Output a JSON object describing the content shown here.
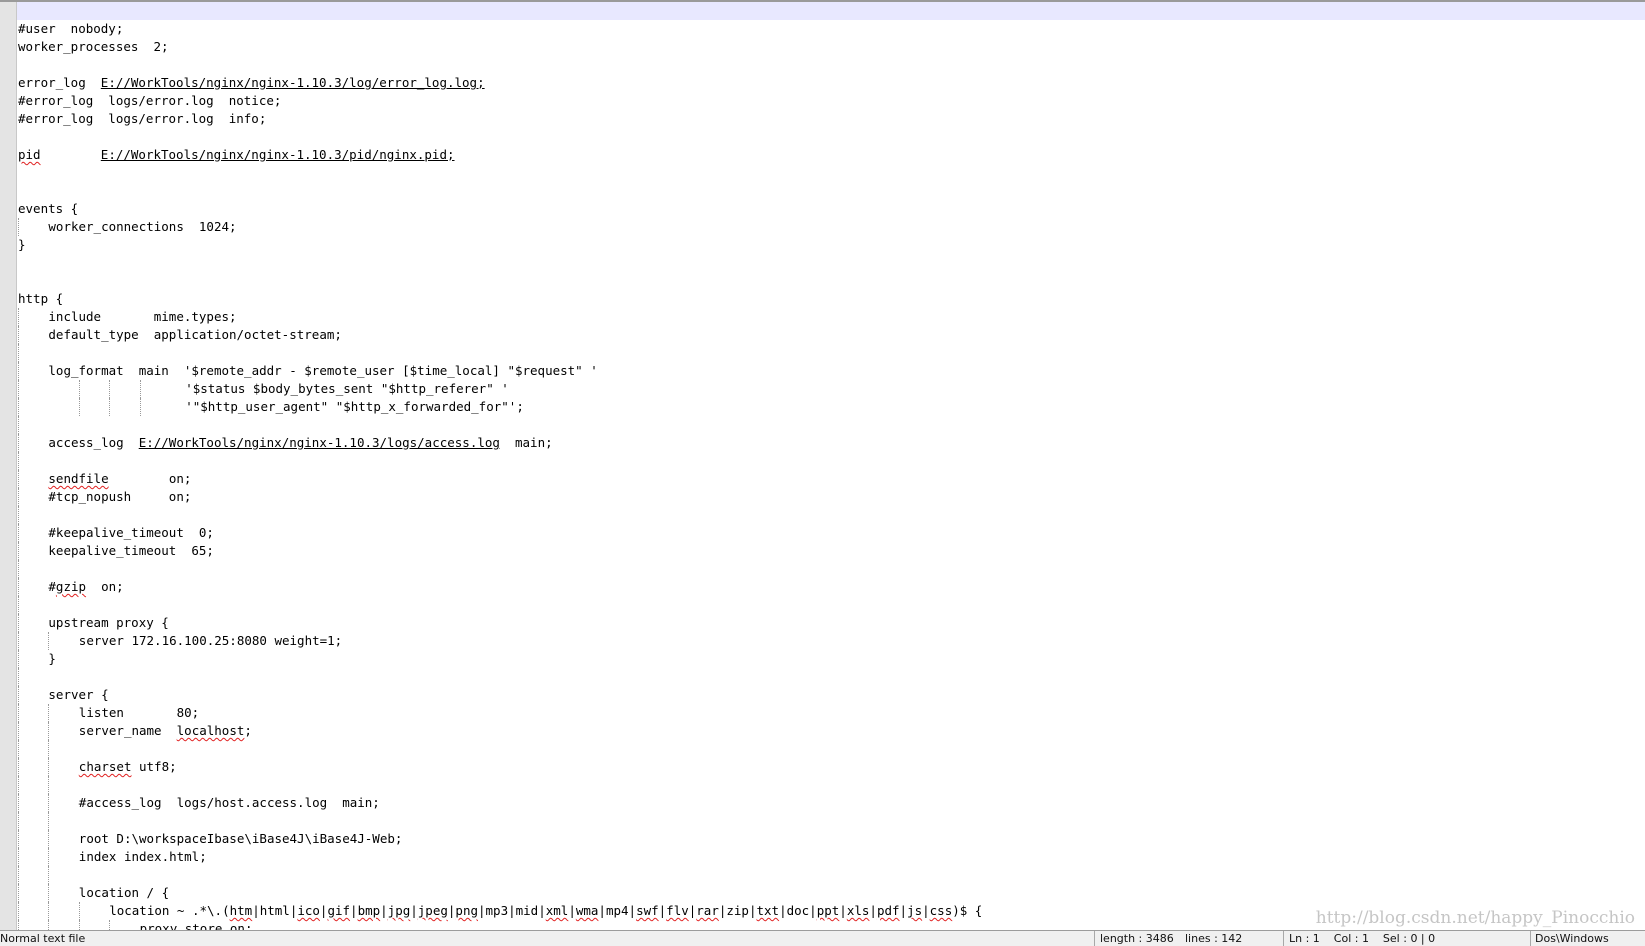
{
  "editor": {
    "lines": [
      {
        "indent": 0,
        "segs": [
          {
            "t": "#user  nobody;"
          }
        ]
      },
      {
        "indent": 0,
        "segs": [
          {
            "t": "worker_processes  2;"
          }
        ]
      },
      {
        "indent": 0,
        "segs": []
      },
      {
        "indent": 0,
        "segs": [
          {
            "t": "error_log  "
          },
          {
            "t": "E://WorkTools/nginx/nginx-1.10.3/log/error_log.log;",
            "s": "ul"
          }
        ]
      },
      {
        "indent": 0,
        "segs": [
          {
            "t": "#error_log  logs/error.log  notice;"
          }
        ]
      },
      {
        "indent": 0,
        "segs": [
          {
            "t": "#error_log  logs/error.log  info;"
          }
        ]
      },
      {
        "indent": 0,
        "segs": []
      },
      {
        "indent": 0,
        "segs": [
          {
            "t": "pid",
            "s": "sq"
          },
          {
            "t": "        "
          },
          {
            "t": "E://WorkTools/nginx/nginx-1.10.3/pid/nginx.pid;",
            "s": "ul"
          }
        ]
      },
      {
        "indent": 0,
        "segs": []
      },
      {
        "indent": 0,
        "segs": []
      },
      {
        "indent": 0,
        "segs": [
          {
            "t": "events {"
          }
        ]
      },
      {
        "indent": 1,
        "segs": [
          {
            "t": "worker_connections  1024;"
          }
        ]
      },
      {
        "indent": 0,
        "segs": [
          {
            "t": "}"
          }
        ]
      },
      {
        "indent": 0,
        "segs": []
      },
      {
        "indent": 0,
        "segs": []
      },
      {
        "indent": 0,
        "segs": [
          {
            "t": "http {"
          }
        ]
      },
      {
        "indent": 1,
        "segs": [
          {
            "t": "include       mime.types;"
          }
        ]
      },
      {
        "indent": 1,
        "segs": [
          {
            "t": "default_type  application/octet-stream;"
          }
        ]
      },
      {
        "indent": 1,
        "segs": []
      },
      {
        "indent": 1,
        "segs": [
          {
            "t": "log_format  main  '$remote_addr - $remote_user [$time_local] \"$request\" '"
          }
        ]
      },
      {
        "indent": 1,
        "cont": true,
        "segs": [
          {
            "t": "'$status $body_bytes_sent \"$http_referer\" '"
          }
        ]
      },
      {
        "indent": 1,
        "cont": true,
        "segs": [
          {
            "t": "'\"$http_user_agent\" \"$http_x_forwarded_for\"';"
          }
        ]
      },
      {
        "indent": 1,
        "segs": []
      },
      {
        "indent": 1,
        "segs": [
          {
            "t": "access_log  "
          },
          {
            "t": "E://WorkTools/nginx/nginx-1.10.3/logs/access.log",
            "s": "ul"
          },
          {
            "t": "  main;"
          }
        ]
      },
      {
        "indent": 1,
        "segs": []
      },
      {
        "indent": 1,
        "segs": [
          {
            "t": "sendfile",
            "s": "sq"
          },
          {
            "t": "        on;"
          }
        ]
      },
      {
        "indent": 1,
        "segs": [
          {
            "t": "#tcp_nopush     on;"
          }
        ]
      },
      {
        "indent": 1,
        "segs": []
      },
      {
        "indent": 1,
        "segs": [
          {
            "t": "#keepalive_timeout  0;"
          }
        ]
      },
      {
        "indent": 1,
        "segs": [
          {
            "t": "keepalive_timeout  65;"
          }
        ]
      },
      {
        "indent": 1,
        "segs": []
      },
      {
        "indent": 1,
        "segs": [
          {
            "t": "#"
          },
          {
            "t": "gzip",
            "s": "sq"
          },
          {
            "t": "  on;"
          }
        ]
      },
      {
        "indent": 1,
        "segs": []
      },
      {
        "indent": 1,
        "segs": [
          {
            "t": "upstream proxy {"
          }
        ]
      },
      {
        "indent": 2,
        "segs": [
          {
            "t": "server 172.16.100.25:8080 weight=1;"
          }
        ]
      },
      {
        "indent": 1,
        "segs": [
          {
            "t": "}"
          }
        ]
      },
      {
        "indent": 1,
        "segs": []
      },
      {
        "indent": 1,
        "segs": [
          {
            "t": "server {"
          }
        ]
      },
      {
        "indent": 2,
        "segs": [
          {
            "t": "listen       80;"
          }
        ]
      },
      {
        "indent": 2,
        "segs": [
          {
            "t": "server_name  "
          },
          {
            "t": "localhost",
            "s": "sq"
          },
          {
            "t": ";"
          }
        ]
      },
      {
        "indent": 2,
        "segs": []
      },
      {
        "indent": 2,
        "segs": [
          {
            "t": "charset",
            "s": "sq"
          },
          {
            "t": " utf8;"
          }
        ]
      },
      {
        "indent": 2,
        "segs": []
      },
      {
        "indent": 2,
        "segs": [
          {
            "t": "#access_log  logs/host.access.log  main;"
          }
        ]
      },
      {
        "indent": 2,
        "segs": []
      },
      {
        "indent": 2,
        "segs": [
          {
            "t": "root D:\\workspaceIbase\\iBase4J\\iBase4J-Web;"
          }
        ]
      },
      {
        "indent": 2,
        "segs": [
          {
            "t": "index index.html;"
          }
        ]
      },
      {
        "indent": 2,
        "segs": []
      },
      {
        "indent": 2,
        "segs": [
          {
            "t": "location / {"
          }
        ]
      },
      {
        "indent": 3,
        "segs": [
          {
            "t": "location ~ .*\\.("
          },
          {
            "t": "htm",
            "s": "sq"
          },
          {
            "t": "|html|"
          },
          {
            "t": "ico",
            "s": "sq"
          },
          {
            "t": "|"
          },
          {
            "t": "gif",
            "s": "sq"
          },
          {
            "t": "|"
          },
          {
            "t": "bmp",
            "s": "sq"
          },
          {
            "t": "|"
          },
          {
            "t": "jpg",
            "s": "sq"
          },
          {
            "t": "|"
          },
          {
            "t": "jpeg",
            "s": "sq"
          },
          {
            "t": "|"
          },
          {
            "t": "png",
            "s": "sq"
          },
          {
            "t": "|mp3|mid|"
          },
          {
            "t": "xml",
            "s": "sq"
          },
          {
            "t": "|"
          },
          {
            "t": "wma",
            "s": "sq"
          },
          {
            "t": "|mp4|"
          },
          {
            "t": "swf",
            "s": "sq"
          },
          {
            "t": "|"
          },
          {
            "t": "flv",
            "s": "sq"
          },
          {
            "t": "|"
          },
          {
            "t": "rar",
            "s": "sq"
          },
          {
            "t": "|zip|"
          },
          {
            "t": "txt",
            "s": "sq"
          },
          {
            "t": "|doc|"
          },
          {
            "t": "ppt",
            "s": "sq"
          },
          {
            "t": "|"
          },
          {
            "t": "xls",
            "s": "sq"
          },
          {
            "t": "|"
          },
          {
            "t": "pdf",
            "s": "sq"
          },
          {
            "t": "|"
          },
          {
            "t": "js",
            "s": "sq"
          },
          {
            "t": "|"
          },
          {
            "t": "css",
            "s": "sq"
          },
          {
            "t": ")$ {"
          }
        ]
      },
      {
        "indent": 4,
        "segs": [
          {
            "t": "proxy_store on;"
          }
        ]
      }
    ]
  },
  "status": {
    "file_type": "Normal text file",
    "length": "length : 3486",
    "lines": "lines : 142",
    "position": "Ln : 1    Col : 1    Sel : 0 | 0",
    "eol": "Dos\\Windows"
  },
  "watermark": "http://blog.csdn.net/happy_Pinocchio"
}
